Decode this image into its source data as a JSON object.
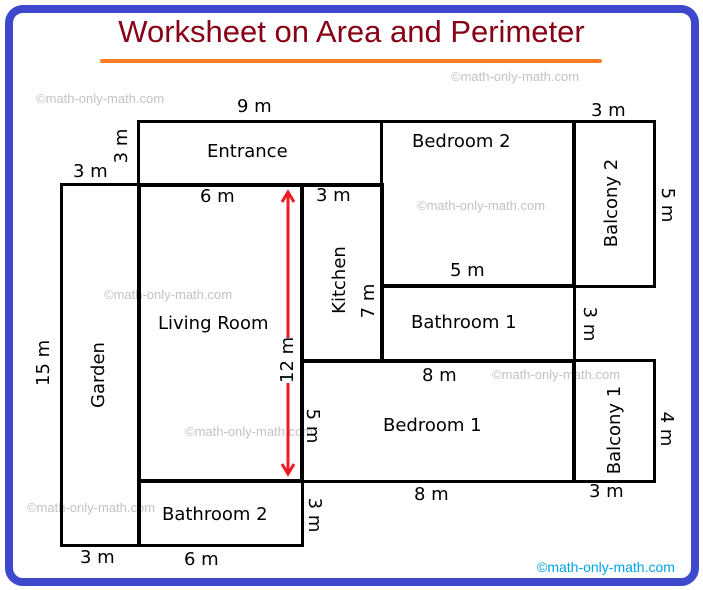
{
  "title": "Worksheet on Area and Perimeter",
  "colors": {
    "frame": "#3f48cc",
    "title": "#880015",
    "underline": "#ff7f27",
    "arrow": "#ed1c24",
    "watermark": "#c3c3c3",
    "watermark_footer": "#00a2e8"
  },
  "rooms": {
    "entrance": "Entrance",
    "bedroom2": "Bedroom 2",
    "balcony2": "Balcony 2",
    "kitchen": "Kitchen",
    "living_room": "Living Room",
    "bathroom1": "Bathroom 1",
    "garden": "Garden",
    "bedroom1": "Bedroom 1",
    "balcony1": "Balcony 1",
    "bathroom2": "Bathroom 2"
  },
  "dimensions": {
    "entrance_width": "9 m",
    "entrance_height": "3 m",
    "garden_top": "3 m",
    "garden_height": "15 m",
    "garden_bottom": "3 m",
    "living_width": "6 m",
    "living_height": "12 m",
    "kitchen_width": "3 m",
    "kitchen_height": "7 m",
    "bedroom2_width": "5 m",
    "balcony2_width": "3 m",
    "balcony2_height": "5 m",
    "bathroom1_height": "3 m",
    "bedroom1_top": "8 m",
    "bedroom1_height": "5 m",
    "bedroom1_bottom": "8 m",
    "balcony1_height": "4 m",
    "balcony1_width": "3 m",
    "bathroom2_width": "6 m",
    "bathroom2_height": "3 m"
  },
  "watermarks": {
    "text": "©math-only-math.com"
  }
}
